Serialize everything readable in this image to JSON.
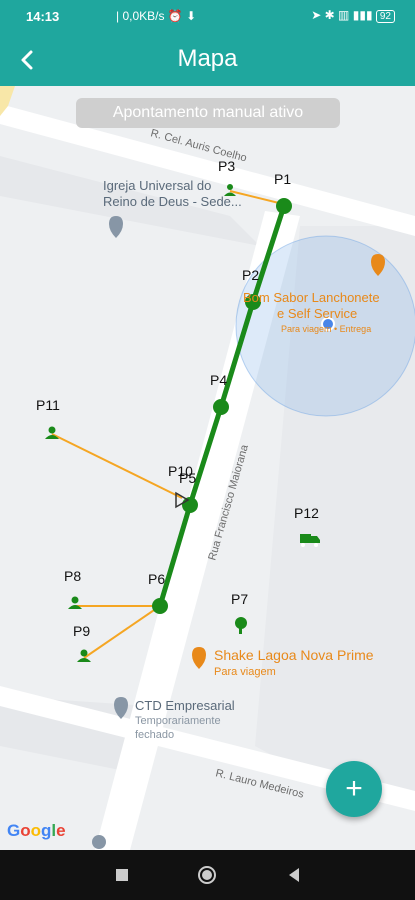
{
  "status_bar": {
    "time": "14:13",
    "network_speed": "0,0KB/s",
    "battery": "92"
  },
  "app_bar": {
    "title": "Mapa",
    "back_icon": "arrow-back-icon"
  },
  "banner": {
    "text": "Apontamento manual ativo"
  },
  "streets": {
    "top": "R. Cel. Auris Coelho",
    "middle": "Rua Francisco Maiorana",
    "bottom": "R. Lauro Medeiros"
  },
  "places": [
    {
      "name_line1": "Igreja Universal do",
      "name_line2": "Reino de Deus - Sede..."
    },
    {
      "name_line1": "Bom Sabor Lanchonete",
      "name_line2": "e Self Service",
      "sub": "Para viagem • Entrega"
    },
    {
      "name_line1": "Shake Lagoa Nova Prime",
      "sub": "Para viagem"
    },
    {
      "name_line1": "CTD Empresarial",
      "sub1": "Temporariamente",
      "sub2": "fechado"
    }
  ],
  "points": {
    "p1": "P1",
    "p2": "P2",
    "p3": "P3",
    "p4": "P4",
    "p5": "P5",
    "p6": "P6",
    "p7": "P7",
    "p8": "P8",
    "p9": "P9",
    "p10": "P10",
    "p11": "P11",
    "p12": "P12"
  },
  "fab": {
    "label": "+"
  },
  "google": {
    "text": "Google"
  },
  "colors": {
    "primary": "#1fa79e",
    "route": "#1a8a1a",
    "link": "#f5a623",
    "poi_orange": "#e8891a"
  }
}
